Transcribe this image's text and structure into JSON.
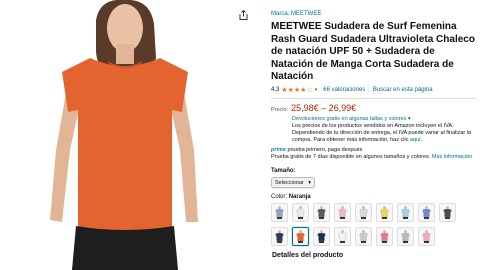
{
  "product": {
    "brand": "Marca: MEETWEE",
    "title": "MEETWEE Sudadera de Surf Femenina Rash Guard Sudadera Ultravioleta Chaleco de natación UPF 50 + Sudadera de Natación de Manga Corta Sudadera de Natación",
    "rating": "4,3",
    "stars_fill": 4.3,
    "reviews": "66 valoraciones",
    "search_link": "Buscar en esta página",
    "price_label": "Precio:",
    "price": "25,98€ – 26,99€"
  },
  "returns": {
    "link": "Devoluciones gratis en algunas tallas y colores",
    "text": "Los precios de los productos vendidos en Amazon incluyen el IVA. Dependiendo de tu dirección de entrega, el IVA puede variar al finalizar la compra. Para obtener más información, haz clic",
    "here": "aquí."
  },
  "prime": {
    "logo": "prime",
    "line1": "prueba primero, paga después",
    "line2": "Prueba gratis de 7 días disponible en algunos tamaños y colores.",
    "more": "Más información"
  },
  "size": {
    "label": "Tamaño:",
    "selected": "Seleccionar"
  },
  "color": {
    "label": "Color:",
    "value": "Naranja",
    "swatches": [
      {
        "color": "#8fa3c7"
      },
      {
        "color": "#e8e8e8"
      },
      {
        "color": "#5a5a5a"
      },
      {
        "color": "#f4b6c2"
      },
      {
        "color": "#d9d9d9"
      },
      {
        "color": "#e8d84a"
      },
      {
        "color": "#9fd0e6"
      },
      {
        "color": "#6e89c7"
      },
      {
        "color": "#4a4a4a"
      },
      {
        "color": "#2b3a55"
      },
      {
        "color": "#e3642f"
      },
      {
        "color": "#1f2f4f"
      },
      {
        "color": "#f2f2f2"
      },
      {
        "color": "#c9c9c9"
      },
      {
        "color": "#e87a8e"
      },
      {
        "color": "#b9b9b9"
      },
      {
        "color": "#f5a9c4"
      }
    ],
    "selected_index": 10
  },
  "details": {
    "title": "Detalles del producto"
  },
  "colors": {
    "shirt": "#e3642f",
    "link": "#007185",
    "price": "#b12704",
    "stars": "#de7921"
  }
}
